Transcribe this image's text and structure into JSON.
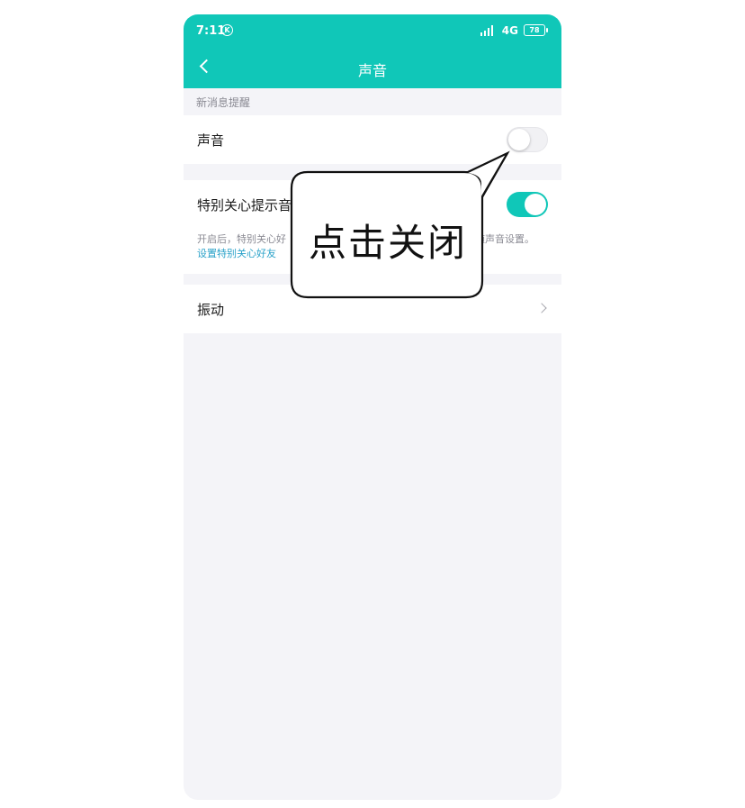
{
  "status_bar": {
    "time": "7:11",
    "k_icon": "K",
    "network": "4G",
    "battery": "78"
  },
  "nav": {
    "title": "声音",
    "back_icon": "chevron-left-icon"
  },
  "section": {
    "header": "新消息提醒"
  },
  "settings": {
    "sound": {
      "label": "声音",
      "enabled": false
    },
    "special_care": {
      "label": "特别关心提示音",
      "enabled": true,
      "desc_start": "开启后，特别关心好",
      "desc_end": "随声音设置。",
      "link": "设置特别关心好友"
    },
    "vibration": {
      "label": "振动"
    }
  },
  "callout": {
    "text": "点击关闭"
  },
  "colors": {
    "accent": "#10c7b8",
    "link": "#2aa2c9",
    "page_bg": "#f4f4f8"
  }
}
